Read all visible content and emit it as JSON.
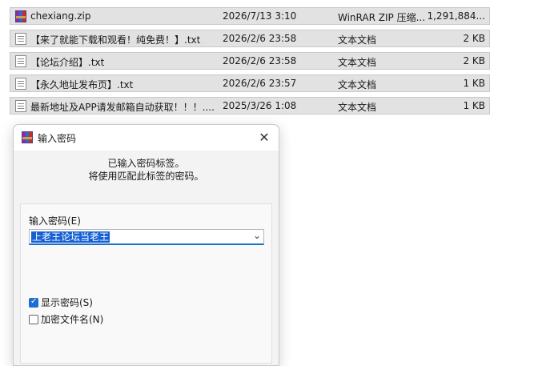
{
  "files": [
    {
      "name": "chexiang.zip",
      "date": "2026/7/13 3:10",
      "type": "WinRAR ZIP 压缩...",
      "size": "1,291,884...",
      "icon": "rar-archive-icon"
    },
    {
      "name": "【来了就能下载和观看！纯免费！】.txt",
      "date": "2026/2/6 23:58",
      "type": "文本文档",
      "size": "2 KB",
      "icon": "text-file-icon"
    },
    {
      "name": "【论坛介绍】.txt",
      "date": "2026/2/6 23:58",
      "type": "文本文档",
      "size": "2 KB",
      "icon": "text-file-icon"
    },
    {
      "name": "【永久地址发布页】.txt",
      "date": "2026/2/6 23:57",
      "type": "文本文档",
      "size": "1 KB",
      "icon": "text-file-icon"
    },
    {
      "name": "最新地址及APP请发邮箱自动获取！！！....",
      "date": "2025/3/26 1:08",
      "type": "文本文档",
      "size": "1 KB",
      "icon": "text-file-icon"
    }
  ],
  "dialog": {
    "title": "输入密码",
    "close_icon": "close-icon",
    "message_line1": "已输入密码标签。",
    "message_line2": "将使用匹配此标签的密码。",
    "password_label": "输入密码(E)",
    "password_value": "上老王论坛当老王",
    "show_password_label": "显示密码(S)",
    "show_password_checked": true,
    "encrypt_names_label": "加密文件名(N)",
    "encrypt_names_checked": false
  },
  "colors": {
    "selection": "#1660d4",
    "checkbox_checked": "#1f6fd0",
    "row_bg": "#e2e2e2"
  }
}
